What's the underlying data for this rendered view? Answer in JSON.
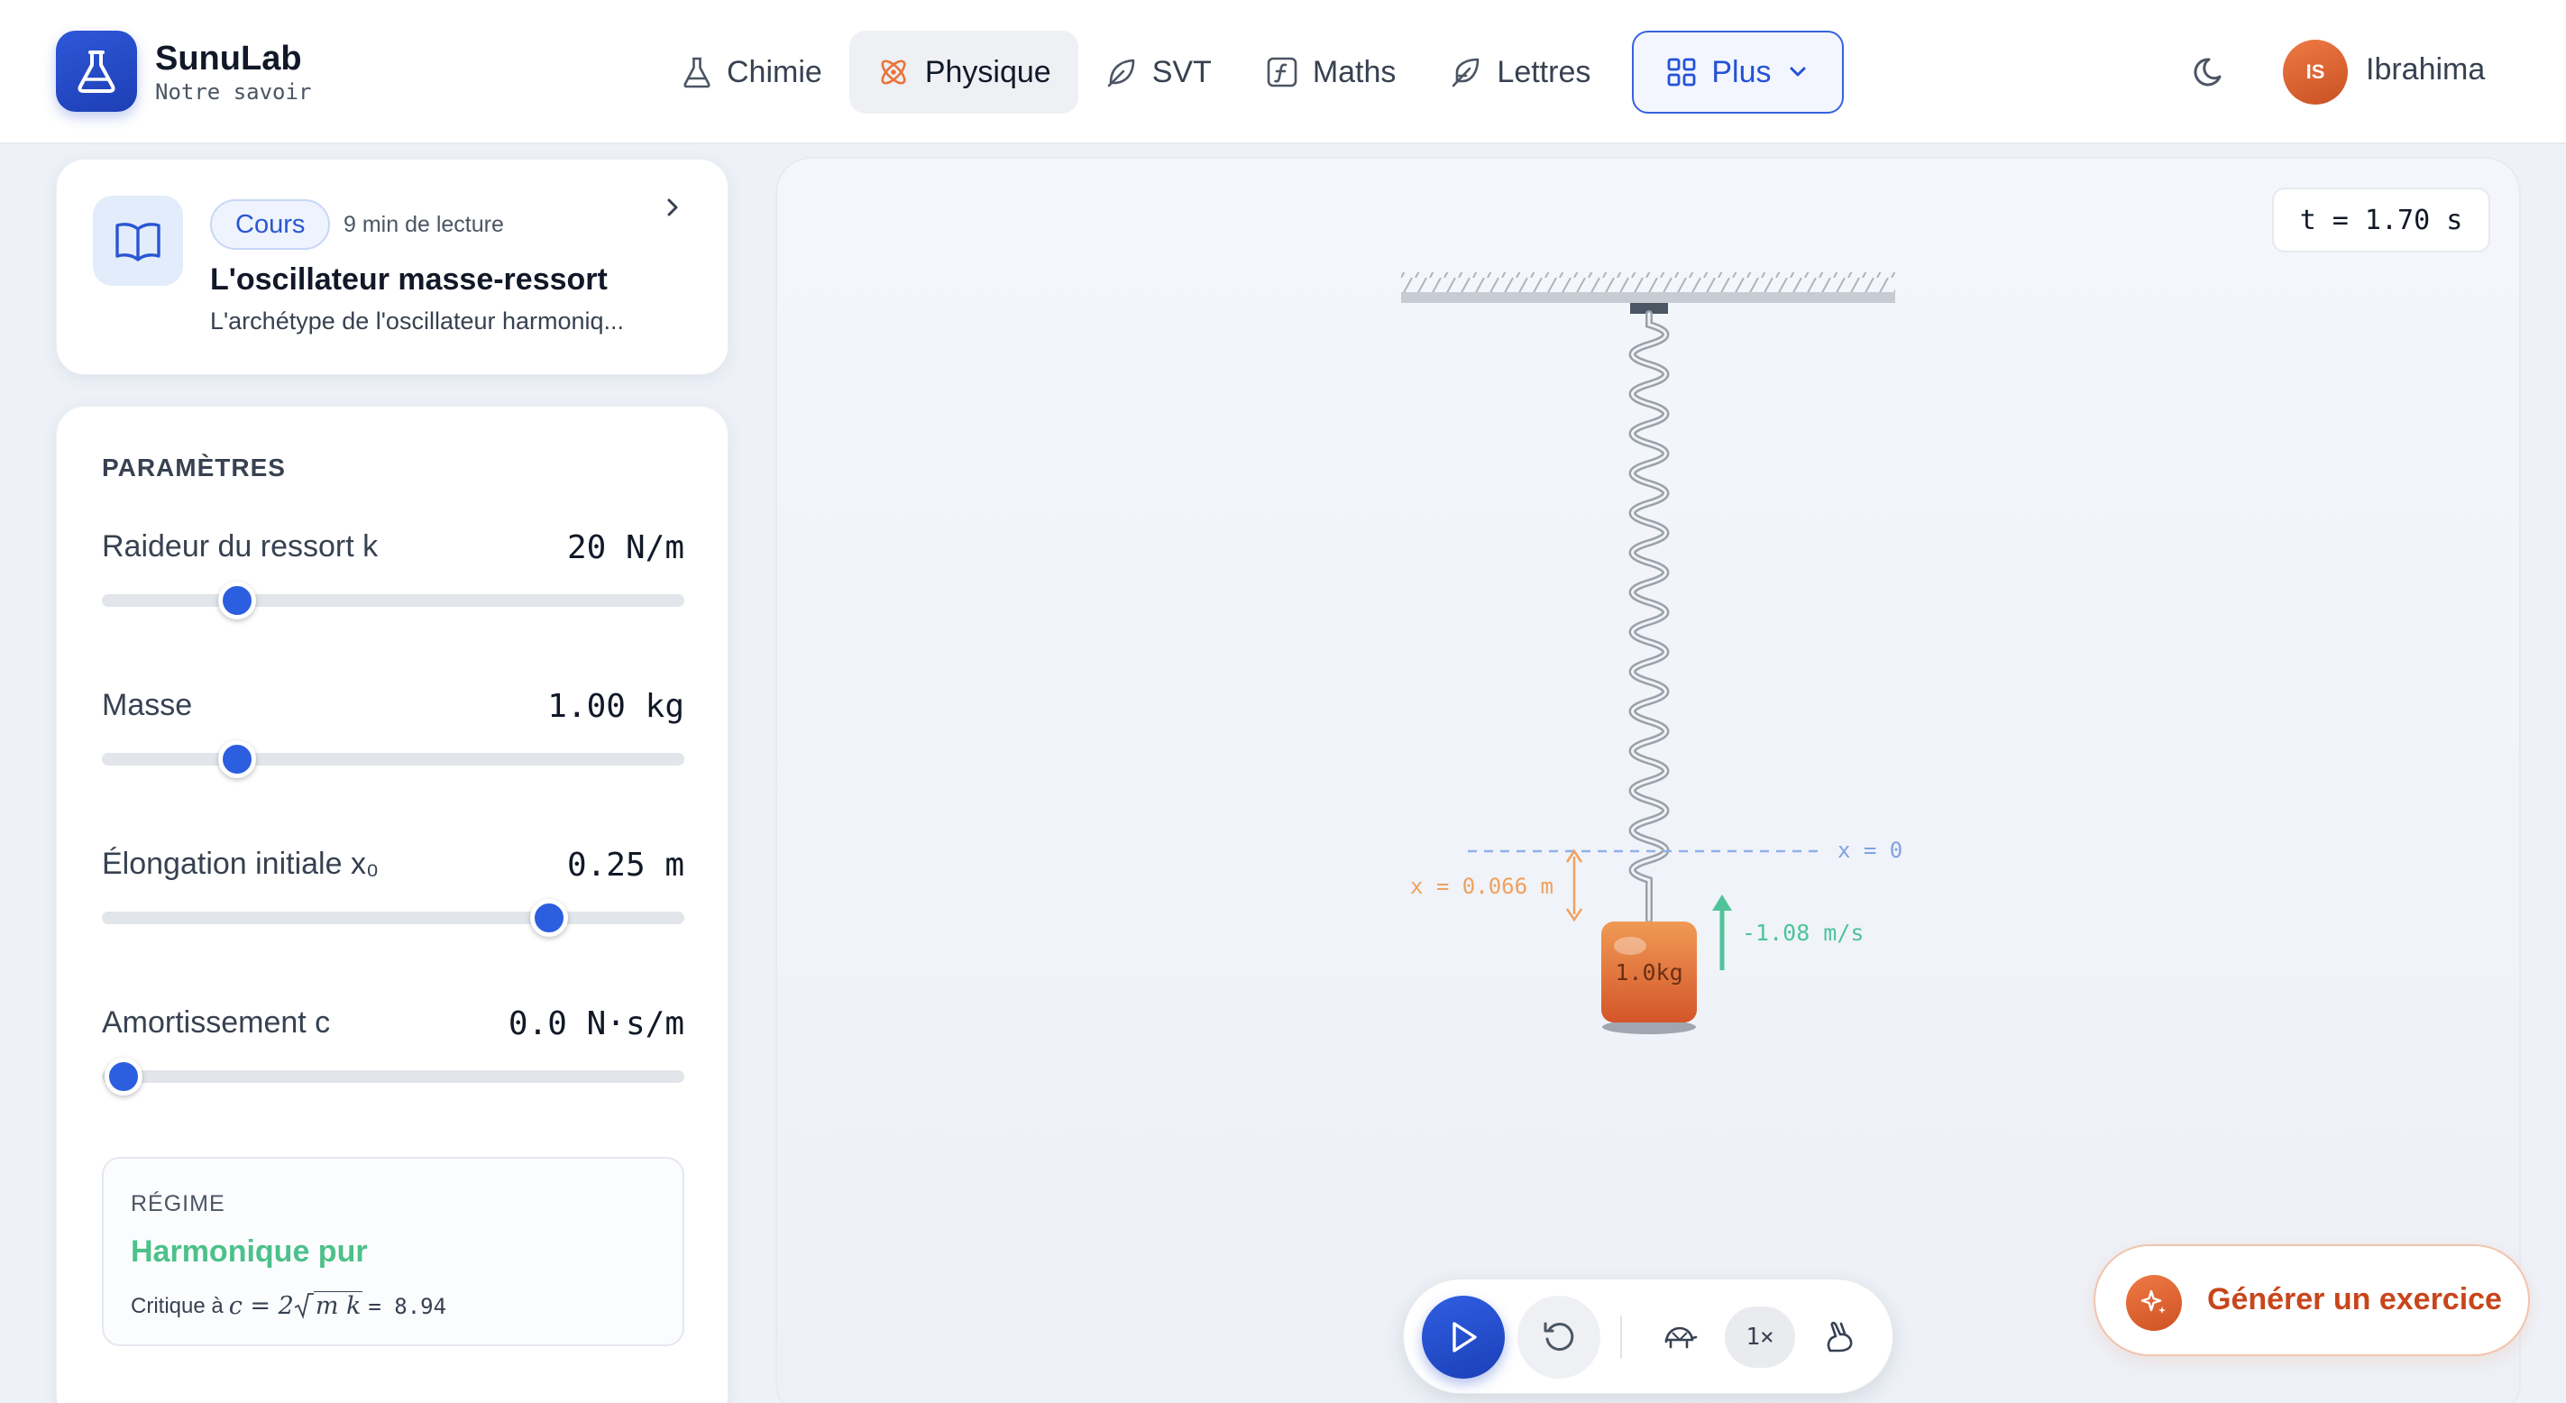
{
  "brand": {
    "name": "SunuLab",
    "tagline": "Notre savoir"
  },
  "nav": {
    "items": [
      {
        "label": "Chimie",
        "icon": "flask-icon"
      },
      {
        "label": "Physique",
        "icon": "atom-icon",
        "active": true
      },
      {
        "label": "SVT",
        "icon": "leaf-icon"
      },
      {
        "label": "Maths",
        "icon": "function-icon"
      },
      {
        "label": "Lettres",
        "icon": "feather-icon"
      }
    ],
    "more_label": "Plus"
  },
  "user": {
    "initials": "IS",
    "name": "Ibrahima"
  },
  "course": {
    "badge": "Cours",
    "read_time": "9 min de lecture",
    "title": "L'oscillateur masse-ressort",
    "description": "L'archétype de l'oscillateur harmoniq..."
  },
  "params": {
    "title": "PARAMÈTRES",
    "stiffness": {
      "label": "Raideur du ressort k",
      "value": "20 N/m",
      "fraction": 0.21
    },
    "mass": {
      "label": "Masse",
      "value": "1.00 kg",
      "fraction": 0.21
    },
    "elongation": {
      "label": "Élongation initiale x₀",
      "value": "0.25 m",
      "fraction": 0.79
    },
    "damping": {
      "label": "Amortissement c",
      "value": "0.0 N·s/m",
      "fraction": 0.0
    }
  },
  "regime": {
    "title": "RÉGIME",
    "value": "Harmonique pur",
    "critical_prefix": "Critique à",
    "critical_value": "= 8.94"
  },
  "simulation": {
    "time_label": "t = 1.70 s",
    "equilibrium_label": "x = 0",
    "displacement_label": "x = 0.066 m",
    "velocity_label": "-1.08 m/s",
    "mass_label": "1.0kg"
  },
  "controls": {
    "speed_label": "1×"
  },
  "generate_label": "Générer un exercice",
  "colors": {
    "accent": "#2c5ee0",
    "physics": "#e8743b",
    "regime": "#4cc18a",
    "displacement": "#f0a15e",
    "velocity": "#4fc39a",
    "equilibrium": "#8fb0ea"
  }
}
